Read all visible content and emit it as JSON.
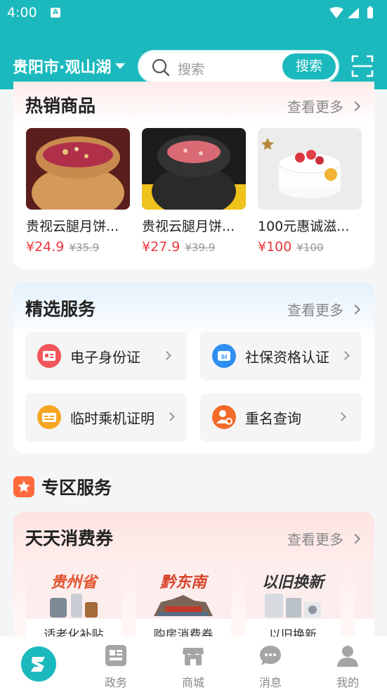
{
  "status": {
    "time": "4:00",
    "app_badge": "A"
  },
  "header": {
    "city": "贵阳市·观山湖",
    "search_placeholder": "搜索",
    "search_button": "搜索"
  },
  "hot": {
    "title": "热销商品",
    "more": "查看更多",
    "products": [
      {
        "name": "贵视云腿月饼...",
        "price": "¥24.9",
        "orig": "¥35.9"
      },
      {
        "name": "贵视云腿月饼...",
        "price": "¥27.9",
        "orig": "¥39.9"
      },
      {
        "name": "100元惠诚滋...",
        "price": "¥100",
        "orig": "¥100"
      }
    ]
  },
  "services": {
    "title": "精选服务",
    "more": "查看更多",
    "items": [
      {
        "label": "电子身份证",
        "color": "#f0565b"
      },
      {
        "label": "社保资格认证",
        "color": "#2f8ff0"
      },
      {
        "label": "临时乘机证明",
        "color": "#f6a623"
      },
      {
        "label": "重名查询",
        "color": "#f26b2a"
      }
    ]
  },
  "zone": {
    "title": "专区服务"
  },
  "coupons": {
    "title": "天天消费券",
    "more": "查看更多",
    "items": [
      {
        "art_title": "贵州省",
        "label": "适老化补贴"
      },
      {
        "art_title": "黔东南",
        "label": "购房消费券"
      },
      {
        "art_title": "以旧换新",
        "label": "以旧换新"
      }
    ]
  },
  "nav": {
    "items": [
      {
        "label": ""
      },
      {
        "label": "政务"
      },
      {
        "label": "商城"
      },
      {
        "label": "消息"
      },
      {
        "label": "我的"
      }
    ]
  }
}
